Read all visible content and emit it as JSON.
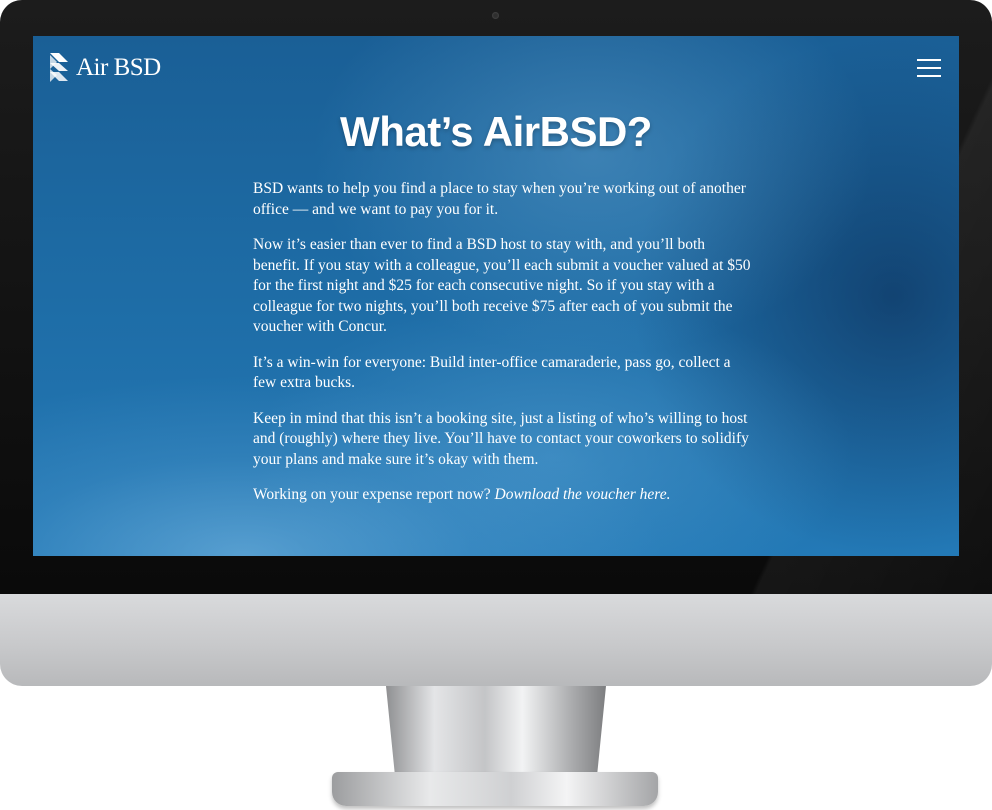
{
  "header": {
    "logo_text": "Air BSD",
    "menu_icon": "hamburger-menu-icon"
  },
  "main": {
    "title": "What’s AirBSD?",
    "paragraphs": [
      "BSD wants to help you find a place to stay when you’re working out of another office — and we want to pay you for it.",
      "Now it’s easier than ever to find a BSD host to stay with, and you’ll both benefit. If you stay with a colleague, you’ll each submit a voucher valued at $50 for the first night and $25 for each consecutive night. So if you stay with a colleague for two nights, you’ll both receive $75 after each of you submit the voucher with Concur.",
      "It’s a win-win for everyone: Build inter-office camaraderie, pass go, collect a few extra bucks.",
      "Keep in mind that this isn’t a booking site, just a listing of who’s willing to host and (roughly) where they live. You’ll have to contact your coworkers to solidify your plans and make sure it’s okay with them."
    ],
    "expense_prompt": "Working on your expense report now?",
    "voucher_link": "Download the voucher here."
  },
  "colors": {
    "background": "#1d6aa3",
    "text": "#ffffff",
    "bezel": "#111111",
    "chin": "#cfd0d2"
  }
}
